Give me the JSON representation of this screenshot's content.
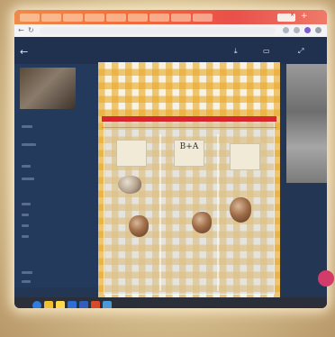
{
  "browser": {
    "tabs": [
      {
        "label": ""
      },
      {
        "label": ""
      },
      {
        "label": ""
      },
      {
        "label": ""
      },
      {
        "label": ""
      },
      {
        "label": ""
      },
      {
        "label": ""
      },
      {
        "label": ""
      },
      {
        "label": ""
      },
      {
        "label": "",
        "active": true
      }
    ],
    "new_tab_icon": "plus-icon",
    "url": ""
  },
  "viewer": {
    "back_icon": "arrow-left-icon",
    "actions": [
      {
        "icon": "download-icon",
        "label": ""
      },
      {
        "icon": "open-with-icon",
        "label": ""
      },
      {
        "icon": "share-icon",
        "label": ""
      }
    ]
  },
  "photo": {
    "subject": "specimens in zip bag on checkered cloth",
    "bag_labels": [
      "",
      "B+A",
      ""
    ],
    "colors": {
      "check": "#e8aa2c",
      "zip": "#d8262a"
    }
  },
  "taskbar": {
    "apps": [
      "chrome-icon",
      "files-icon",
      "docs-icon",
      "outlook-icon",
      "word-icon",
      "powerpoint-icon",
      "photos-icon"
    ],
    "tray_text": ""
  },
  "colors": {
    "viewer_bg": "#233654",
    "tabbar": "#f26a3a"
  }
}
